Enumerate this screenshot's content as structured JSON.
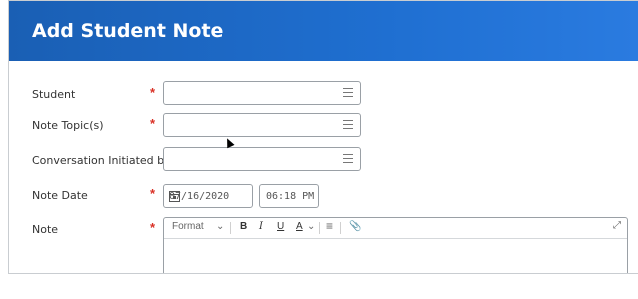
{
  "dialog": {
    "title": "Add Student Note"
  },
  "fields": {
    "student": {
      "label": "Student",
      "required_mark": "*",
      "value": ""
    },
    "note_topics": {
      "label": "Note Topic(s)",
      "required_mark": "*",
      "value": ""
    },
    "conversation_initiated_by": {
      "label": "Conversation Initiated by",
      "value": ""
    },
    "note_date": {
      "label": "Note Date",
      "required_mark": "*",
      "date": "07/16/2020",
      "time": "06:18 PM"
    },
    "note": {
      "label": "Note",
      "required_mark": "*",
      "value": ""
    }
  },
  "editor_toolbar": {
    "format": "Format",
    "bold": "B",
    "italic": "I",
    "underline": "U",
    "font_color": "A"
  },
  "colors": {
    "header": "#1f6fd1",
    "required": "#d93025"
  },
  "icons": [
    "prompt-list-icon",
    "calendar-icon",
    "chevron-down-icon",
    "bullet-list-icon",
    "link-icon",
    "expand-icon"
  ]
}
